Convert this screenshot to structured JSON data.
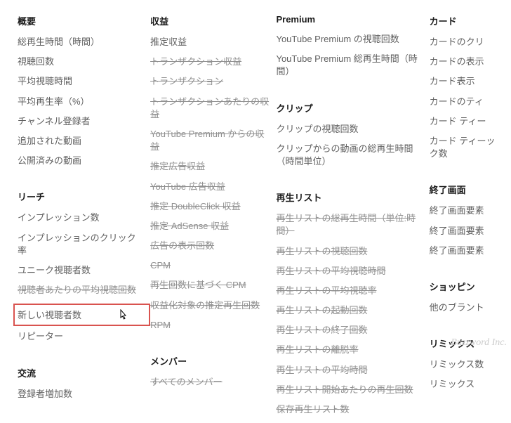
{
  "col1": {
    "s1": {
      "header": "概要",
      "items": [
        {
          "label": "総再生時間（時間）"
        },
        {
          "label": "視聴回数"
        },
        {
          "label": "平均視聴時間"
        },
        {
          "label": "平均再生率（%）"
        },
        {
          "label": "チャンネル登録者"
        },
        {
          "label": "追加された動画"
        },
        {
          "label": "公開済みの動画"
        }
      ]
    },
    "s2": {
      "header": "リーチ",
      "items": [
        {
          "label": "インプレッション数"
        },
        {
          "label": "インプレッションのクリック率"
        },
        {
          "label": "ユニーク視聴者数"
        },
        {
          "label": "視聴者あたりの平均視聴回数",
          "strike": true
        },
        {
          "label": "新しい視聴者数",
          "highlight": true
        },
        {
          "label": "リピーター"
        }
      ]
    },
    "s3": {
      "header": "交流",
      "items": [
        {
          "label": "登録者増加数"
        }
      ]
    }
  },
  "col2": {
    "s1": {
      "header": "収益",
      "items": [
        {
          "label": "推定収益"
        },
        {
          "label": "トランザクション収益",
          "strike": true
        },
        {
          "label": "トランザクション",
          "strike": true
        },
        {
          "label": "トランザクションあたりの収益",
          "strike": true
        },
        {
          "label": "YouTube Premium からの収益",
          "strike": true
        },
        {
          "label": "推定広告収益",
          "strike": true
        },
        {
          "label": "YouTube 広告収益",
          "strike": true
        },
        {
          "label": "推定 DoubleClick 収益",
          "strike": true
        },
        {
          "label": "推定 AdSense 収益",
          "strike": true
        },
        {
          "label": "広告の表示回数",
          "strike": true
        },
        {
          "label": "CPM",
          "strike": true
        },
        {
          "label": "再生回数に基づく CPM",
          "strike": true
        },
        {
          "label": "収益化対象の推定再生回数",
          "strike": true
        },
        {
          "label": "RPM",
          "strike": true
        }
      ]
    },
    "s2": {
      "header": "メンバー",
      "items": [
        {
          "label": "すべてのメンバー",
          "strike": true
        }
      ]
    }
  },
  "col3": {
    "s1": {
      "header": "Premium",
      "items": [
        {
          "label": "YouTube Premium の視聴回数"
        },
        {
          "label": "YouTube Premium 総再生時間（時間）"
        }
      ]
    },
    "s2": {
      "header": "クリップ",
      "items": [
        {
          "label": "クリップの視聴回数"
        },
        {
          "label": "クリップからの動画の総再生時間（時間単位）"
        }
      ]
    },
    "s3": {
      "header": "再生リスト",
      "items": [
        {
          "label": "再生リストの総再生時間（単位:時間）",
          "strike": true
        },
        {
          "label": "再生リストの視聴回数",
          "strike": true
        },
        {
          "label": "再生リストの平均視聴時間",
          "strike": true
        },
        {
          "label": "再生リストの平均視聴率",
          "strike": true
        },
        {
          "label": "再生リストの起動回数",
          "strike": true
        },
        {
          "label": "再生リストの終了回数",
          "strike": true
        },
        {
          "label": "再生リストの離脱率",
          "strike": true
        },
        {
          "label": "再生リストの平均時間",
          "strike": true
        },
        {
          "label": "再生リスト開始あたりの再生回数",
          "strike": true
        },
        {
          "label": "保存再生リスト数",
          "strike": true
        }
      ]
    }
  },
  "col4": {
    "s1": {
      "header": "カード",
      "items": [
        {
          "label": "カードのクリ"
        },
        {
          "label": "カードの表示"
        },
        {
          "label": "カード表示"
        },
        {
          "label": "カードのティ"
        },
        {
          "label": "カード ティー"
        },
        {
          "label": "カード ティーック数"
        }
      ]
    },
    "s2": {
      "header": "終了画面",
      "items": [
        {
          "label": "終了画面要素"
        },
        {
          "label": "終了画面要素"
        },
        {
          "label": "終了画面要素"
        }
      ]
    },
    "s3": {
      "header": "ショッピン",
      "items": [
        {
          "label": "他のブラント"
        }
      ]
    },
    "s4": {
      "header": "リミックス",
      "items": [
        {
          "label": "リミックス数"
        },
        {
          "label": "リミックス"
        }
      ]
    }
  },
  "watermark": "Buzzword Inc."
}
